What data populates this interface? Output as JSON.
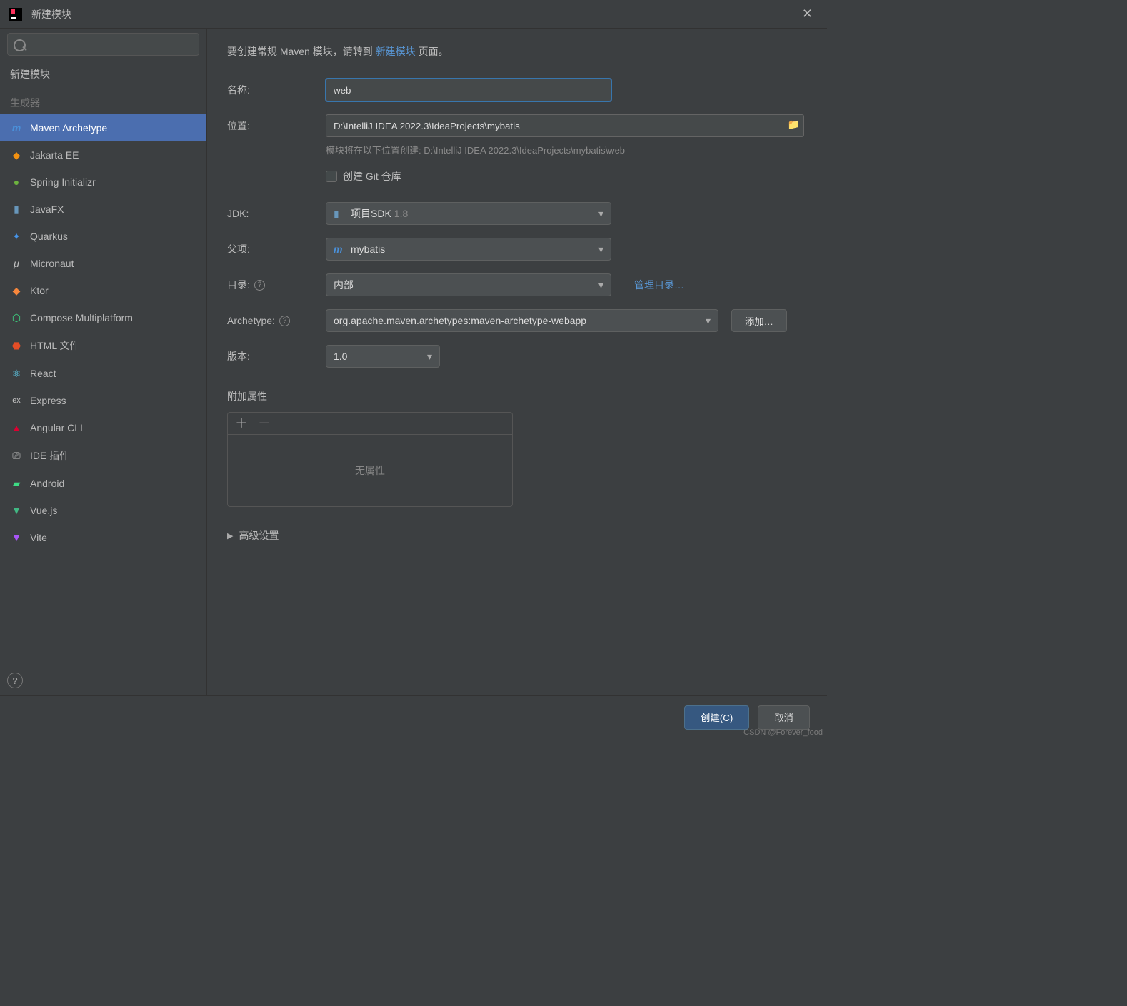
{
  "titlebar": {
    "title": "新建模块"
  },
  "sidebar": {
    "section_new": "新建模块",
    "section_gen": "生成器",
    "items": [
      {
        "label": "Maven Archetype",
        "icon": "m-icon",
        "color": "#4a90d9"
      },
      {
        "label": "Jakarta EE",
        "icon": "jakarta-icon",
        "color": "#f29111"
      },
      {
        "label": "Spring Initializr",
        "icon": "spring-icon",
        "color": "#6db33f"
      },
      {
        "label": "JavaFX",
        "icon": "javafx-icon",
        "color": "#6897bb"
      },
      {
        "label": "Quarkus",
        "icon": "quarkus-icon",
        "color": "#4695eb"
      },
      {
        "label": "Micronaut",
        "icon": "micronaut-icon",
        "color": "#c4c4c4"
      },
      {
        "label": "Ktor",
        "icon": "ktor-icon",
        "color": "#f8873c"
      },
      {
        "label": "Compose Multiplatform",
        "icon": "compose-icon",
        "color": "#3ddc84"
      },
      {
        "label": "HTML 文件",
        "icon": "html-icon",
        "color": "#e44d26"
      },
      {
        "label": "React",
        "icon": "react-icon",
        "color": "#61dafb"
      },
      {
        "label": "Express",
        "icon": "express-icon",
        "color": "#c4c4c4"
      },
      {
        "label": "Angular CLI",
        "icon": "angular-icon",
        "color": "#dd0031"
      },
      {
        "label": "IDE 插件",
        "icon": "plugin-icon",
        "color": "#c4c4c4"
      },
      {
        "label": "Android",
        "icon": "android-icon",
        "color": "#3ddc84"
      },
      {
        "label": "Vue.js",
        "icon": "vue-icon",
        "color": "#41b883"
      },
      {
        "label": "Vite",
        "icon": "vite-icon",
        "color": "#a855f7"
      }
    ]
  },
  "content": {
    "intro_prefix": "要创建常规 Maven 模块，请转到 ",
    "intro_link": "新建模块",
    "intro_suffix": " 页面。",
    "labels": {
      "name": "名称:",
      "location": "位置:",
      "git": "创建 Git 仓库",
      "jdk": "JDK:",
      "parent": "父项:",
      "catalog": "目录:",
      "archetype": "Archetype:",
      "version": "版本:",
      "additional": "附加属性",
      "advanced": "高级设置"
    },
    "name_value": "web",
    "location_value": "D:\\IntelliJ IDEA 2022.3\\IdeaProjects\\mybatis",
    "location_hint": "模块将在以下位置创建: D:\\IntelliJ IDEA 2022.3\\IdeaProjects\\mybatis\\web",
    "jdk_prefix": "项目SDK",
    "jdk_version": "1.8",
    "parent_value": "mybatis",
    "catalog_value": "内部",
    "manage_catalogs": "管理目录…",
    "archetype_value": "org.apache.maven.archetypes:maven-archetype-webapp",
    "add_button": "添加…",
    "version_value": "1.0",
    "no_attributes": "无属性"
  },
  "footer": {
    "create": "创建(C)",
    "cancel": "取消"
  },
  "watermark": "CSDN @Forever_food"
}
